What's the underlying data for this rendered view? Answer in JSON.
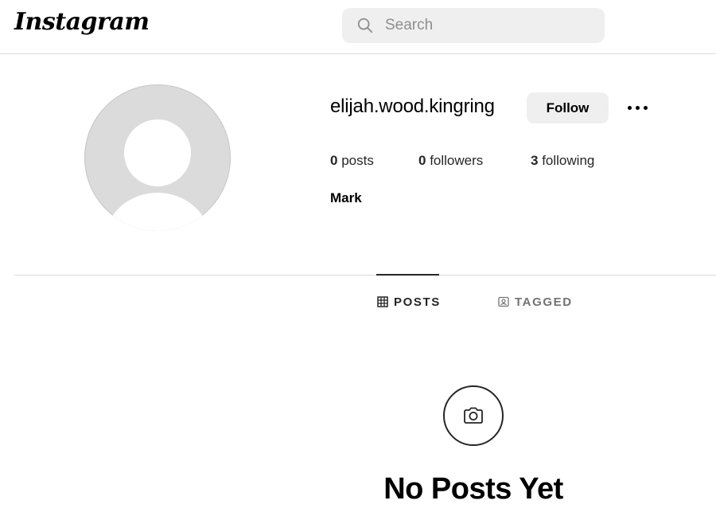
{
  "header": {
    "logo_text": "Instagram",
    "search": {
      "placeholder": "Search",
      "value": "",
      "icon": "search-icon"
    }
  },
  "profile": {
    "avatar_icon": "default-avatar",
    "username": "elijah.wood.kingring",
    "follow_label": "Follow",
    "more_icon": "more-options-icon",
    "stats": {
      "posts_count": "0",
      "posts_label": "posts",
      "followers_count": "0",
      "followers_label": "followers",
      "following_count": "3",
      "following_label": "following"
    },
    "display_name": "Mark"
  },
  "tabs": [
    {
      "label": "POSTS",
      "icon": "grid-icon",
      "active": true
    },
    {
      "label": "TAGGED",
      "icon": "tagged-icon",
      "active": false
    }
  ],
  "empty_state": {
    "icon": "camera-icon",
    "title": "No Posts Yet"
  },
  "colors": {
    "background": "#ffffff",
    "button_bg": "#efefef",
    "divider": "#dbdbdb",
    "muted_text": "#737373",
    "avatar_bg": "#dbdbdb"
  }
}
